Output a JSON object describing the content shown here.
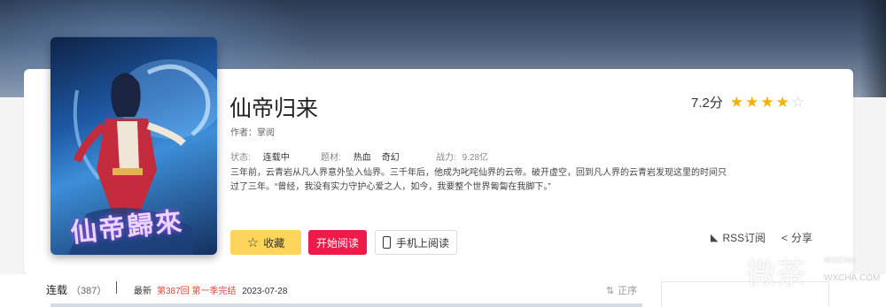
{
  "comic": {
    "title": "仙帝归来",
    "cover_title": "仙帝歸來",
    "author_label": "作者：",
    "author": "掌阅",
    "status_label": "状态:",
    "status": "连载中",
    "genre_label": "题材:",
    "genres": [
      "热血",
      "奇幻"
    ],
    "power_label": "战力:",
    "power": "9.28亿",
    "description": "三年前，云青岩从凡人界意外坠入仙界。三千年后，他成为叱咤仙界的云帝。破开虚空，回到凡人界的云青岩发现这里的时间只过了三年。“曾经，我没有实力守护心爱之人，如今，我要整个世界匍匐在我脚下。”"
  },
  "rating": {
    "score_text": "7.2分",
    "stars_filled": 4,
    "stars_total": 5
  },
  "actions": {
    "favorite": "收藏",
    "start_reading": "开始阅读",
    "mobile_reading": "手机上阅读",
    "rss": "RSS订阅",
    "share": "分享"
  },
  "chapters": {
    "tab_label": "连载",
    "count": "（387）",
    "latest_label": "最新",
    "latest_chapter": "第387回 第一季完结",
    "latest_date": "2023-07-28",
    "sort_label": "正序"
  },
  "watermark": {
    "main": "微茶",
    "sub": "WXCHA",
    "url": "WXCHA.COM"
  },
  "colors": {
    "accent_red": "#ee1a4a",
    "favorite_yellow": "#fcd55a",
    "star": "#f5b100",
    "highlight": "#e0453b"
  },
  "icons": {
    "favorite": "star-outline-icon",
    "mobile": "phone-icon",
    "rss": "signal-icon",
    "share": "share-icon",
    "sort": "sort-icon"
  }
}
